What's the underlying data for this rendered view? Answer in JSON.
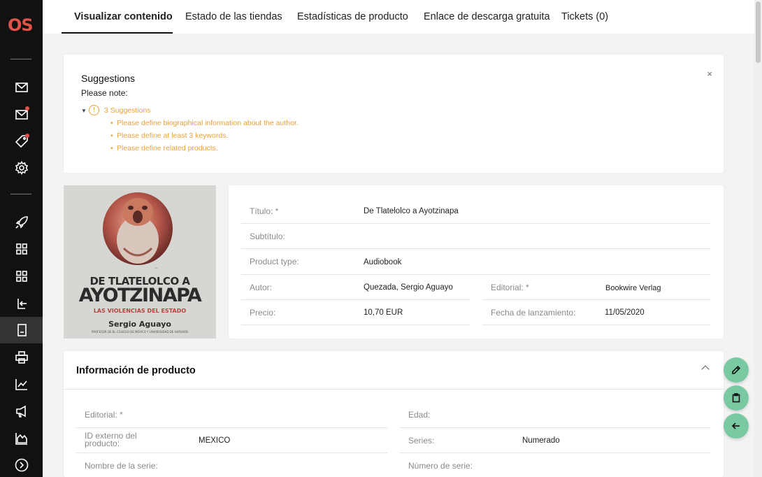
{
  "app": {
    "logo_text": "OS"
  },
  "tabs": [
    {
      "label": "Visualizar contenido",
      "active": true
    },
    {
      "label": "Estado de las tiendas"
    },
    {
      "label": "Estadísticas de producto"
    },
    {
      "label": "Enlace de descarga gratuita"
    },
    {
      "label": "Tickets (0)"
    }
  ],
  "sidebar": {
    "icons": [
      "mail-icon",
      "mail-notification-icon",
      "tag-icon",
      "settings-icon",
      "rocket-icon",
      "grid-icon",
      "grid-icon-2",
      "import-icon",
      "document-icon",
      "printer-icon",
      "chart-line-icon",
      "megaphone-icon",
      "area-chart-icon",
      "expand-icon"
    ]
  },
  "suggestions": {
    "title": "Suggestions",
    "note": "Please note:",
    "count_label": "3 Suggestions",
    "items": [
      "Please define biographical information about the author.",
      "Please define at least 3 keywords.",
      "Please define related products."
    ],
    "close": "×"
  },
  "cover": {
    "title_line1": "DE TLATELOLCO A",
    "title_line2": "AYOTZINAPA",
    "subtitle": "LAS VIOLENCIAS DEL ESTADO",
    "author": "Sergio Aguayo",
    "affiliation": "PROFESOR DE EL COLEGIO DE MÉXICO Y UNIVERSIDAD DE HARVARD"
  },
  "product": {
    "titulo_label": "Título: *",
    "titulo_value": "De Tlatelolco a Ayotzinapa",
    "subtitulo_label": "Subtítulo:",
    "type_label": "Product type:",
    "type_value": "Audiobook",
    "autor_label": "Autor:",
    "autor_value": "Quezada, Sergio Aguayo",
    "editorial_label": "Editorial: *",
    "editorial_value": "Bookwire Verlag",
    "precio_label": "Precio:",
    "precio_value": "10,70 EUR",
    "fecha_label": "Fecha de lanzamiento:",
    "fecha_value": "11/05/2020"
  },
  "info": {
    "title": "Información de producto",
    "editorial_label": "Editorial: *",
    "edad_label": "Edad:",
    "id_externo_label_1": "ID externo del",
    "id_externo_label_2": "producto:",
    "id_externo_value": "MEXICO",
    "series_label": "Series:",
    "series_value": "Numerado",
    "nombre_serie_label": "Nombre de la serie:",
    "numero_serie_label": "Número de serie:"
  },
  "colors": {
    "accent": "#79c9a3",
    "warning": "#e8a23a",
    "logo": "#e0534b"
  }
}
